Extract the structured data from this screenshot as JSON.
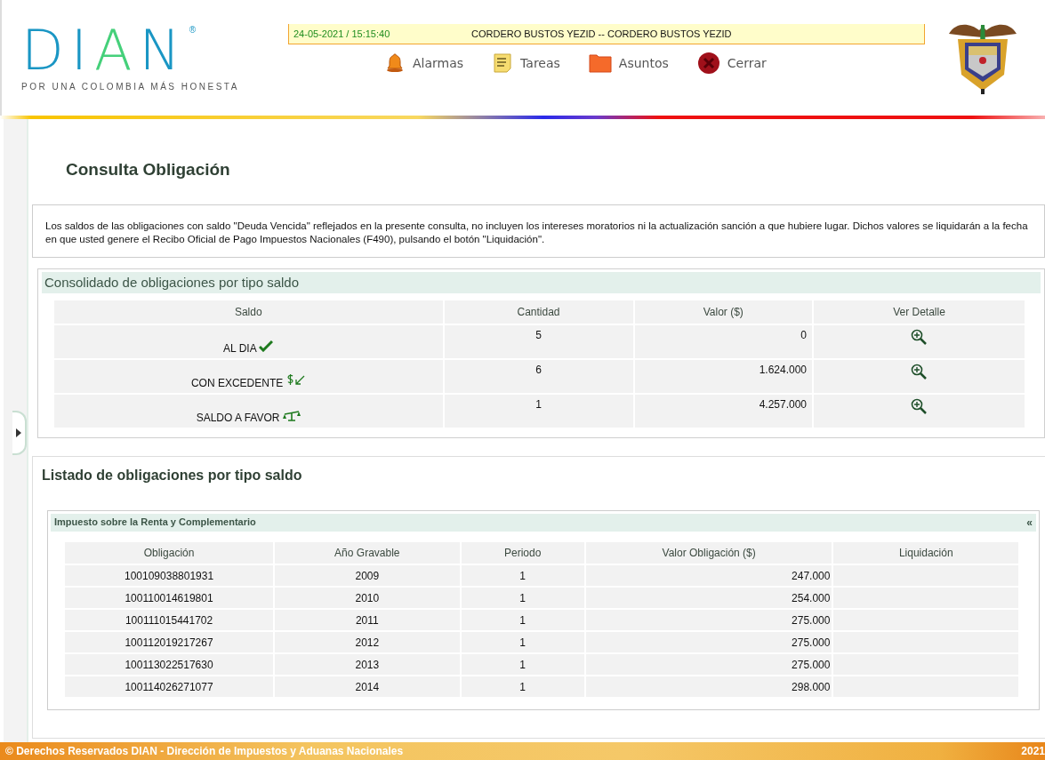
{
  "header": {
    "logo": {
      "text": "DIAN",
      "registered": "®",
      "tagline": "POR UNA COLOMBIA MÁS HONESTA"
    },
    "session_bar": {
      "datetime": "24-05-2021 / 15:15:40",
      "user": "CORDERO BUSTOS YEZID -- CORDERO BUSTOS YEZID"
    },
    "nav": [
      {
        "label": "Alarmas",
        "kind": "alarms"
      },
      {
        "label": "Tareas",
        "kind": "tasks"
      },
      {
        "label": "Asuntos",
        "kind": "matters"
      },
      {
        "label": "Cerrar",
        "kind": "close"
      }
    ]
  },
  "page_title": "Consulta Obligación",
  "notice": "Los saldos de las obligaciones con saldo \"Deuda Vencida\" reflejados en la presente consulta, no incluyen los intereses moratorios ni la actualización sanción a que hubiere lugar. Dichos valores se liquidarán a la fecha en que usted genere el Recibo Oficial de Pago Impuestos Nacionales (F490), pulsando el botón \"Liquidación\".",
  "consolidated": {
    "title": "Consolidado de obligaciones por tipo saldo",
    "columns": [
      "Saldo",
      "Cantidad",
      "Valor ($)",
      "Ver Detalle"
    ],
    "rows": [
      {
        "saldo": "AL DIA",
        "kind": "check",
        "cantidad": "5",
        "valor": "0"
      },
      {
        "saldo": "CON EXCEDENTE",
        "kind": "excess",
        "cantidad": "6",
        "valor": "1.624.000"
      },
      {
        "saldo": "SALDO A FAVOR",
        "kind": "balance",
        "cantidad": "1",
        "valor": "4.257.000"
      }
    ]
  },
  "listing": {
    "title": "Listado de obligaciones por tipo saldo",
    "group": {
      "title": "Impuesto sobre la Renta y Complementario",
      "collapse": "«",
      "columns": [
        "Obligación",
        "Año Gravable",
        "Periodo",
        "Valor Obligación ($)",
        "Liquidación"
      ],
      "rows": [
        [
          "100109038801931",
          "2009",
          "1",
          "247.000"
        ],
        [
          "100110014619801",
          "2010",
          "1",
          "254.000"
        ],
        [
          "100111015441702",
          "2011",
          "1",
          "275.000"
        ],
        [
          "100112019217267",
          "2012",
          "1",
          "275.000"
        ],
        [
          "100113022517630",
          "2013",
          "1",
          "275.000"
        ],
        [
          "100114026271077",
          "2014",
          "1",
          "298.000"
        ]
      ]
    }
  },
  "footer": {
    "text": "© Derechos Reservados DIAN - Dirección de Impuestos y Aduanas Nacionales",
    "year": "2021"
  }
}
